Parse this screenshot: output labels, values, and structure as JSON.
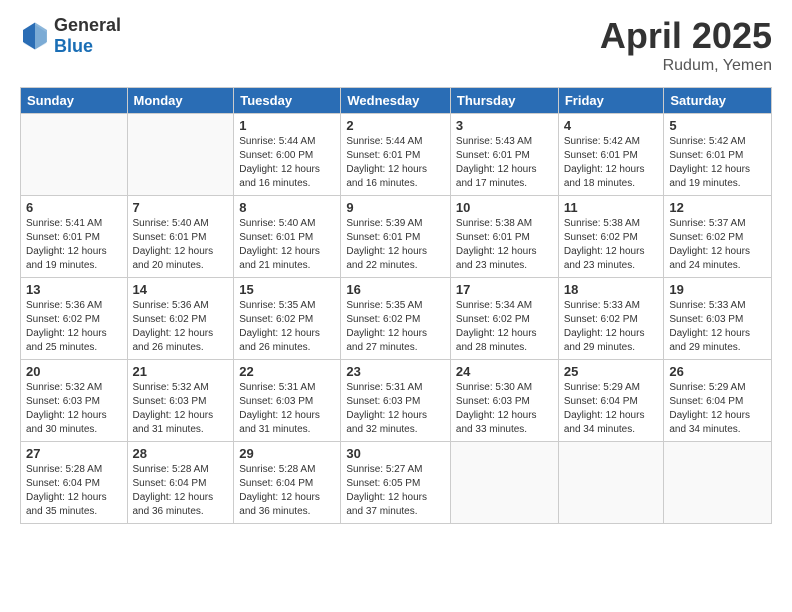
{
  "header": {
    "logo_general": "General",
    "logo_blue": "Blue",
    "month_title": "April 2025",
    "location": "Rudum, Yemen"
  },
  "weekdays": [
    "Sunday",
    "Monday",
    "Tuesday",
    "Wednesday",
    "Thursday",
    "Friday",
    "Saturday"
  ],
  "weeks": [
    [
      {
        "day": "",
        "info": ""
      },
      {
        "day": "",
        "info": ""
      },
      {
        "day": "1",
        "info": "Sunrise: 5:44 AM\nSunset: 6:00 PM\nDaylight: 12 hours and 16 minutes."
      },
      {
        "day": "2",
        "info": "Sunrise: 5:44 AM\nSunset: 6:01 PM\nDaylight: 12 hours and 16 minutes."
      },
      {
        "day": "3",
        "info": "Sunrise: 5:43 AM\nSunset: 6:01 PM\nDaylight: 12 hours and 17 minutes."
      },
      {
        "day": "4",
        "info": "Sunrise: 5:42 AM\nSunset: 6:01 PM\nDaylight: 12 hours and 18 minutes."
      },
      {
        "day": "5",
        "info": "Sunrise: 5:42 AM\nSunset: 6:01 PM\nDaylight: 12 hours and 19 minutes."
      }
    ],
    [
      {
        "day": "6",
        "info": "Sunrise: 5:41 AM\nSunset: 6:01 PM\nDaylight: 12 hours and 19 minutes."
      },
      {
        "day": "7",
        "info": "Sunrise: 5:40 AM\nSunset: 6:01 PM\nDaylight: 12 hours and 20 minutes."
      },
      {
        "day": "8",
        "info": "Sunrise: 5:40 AM\nSunset: 6:01 PM\nDaylight: 12 hours and 21 minutes."
      },
      {
        "day": "9",
        "info": "Sunrise: 5:39 AM\nSunset: 6:01 PM\nDaylight: 12 hours and 22 minutes."
      },
      {
        "day": "10",
        "info": "Sunrise: 5:38 AM\nSunset: 6:01 PM\nDaylight: 12 hours and 23 minutes."
      },
      {
        "day": "11",
        "info": "Sunrise: 5:38 AM\nSunset: 6:02 PM\nDaylight: 12 hours and 23 minutes."
      },
      {
        "day": "12",
        "info": "Sunrise: 5:37 AM\nSunset: 6:02 PM\nDaylight: 12 hours and 24 minutes."
      }
    ],
    [
      {
        "day": "13",
        "info": "Sunrise: 5:36 AM\nSunset: 6:02 PM\nDaylight: 12 hours and 25 minutes."
      },
      {
        "day": "14",
        "info": "Sunrise: 5:36 AM\nSunset: 6:02 PM\nDaylight: 12 hours and 26 minutes."
      },
      {
        "day": "15",
        "info": "Sunrise: 5:35 AM\nSunset: 6:02 PM\nDaylight: 12 hours and 26 minutes."
      },
      {
        "day": "16",
        "info": "Sunrise: 5:35 AM\nSunset: 6:02 PM\nDaylight: 12 hours and 27 minutes."
      },
      {
        "day": "17",
        "info": "Sunrise: 5:34 AM\nSunset: 6:02 PM\nDaylight: 12 hours and 28 minutes."
      },
      {
        "day": "18",
        "info": "Sunrise: 5:33 AM\nSunset: 6:02 PM\nDaylight: 12 hours and 29 minutes."
      },
      {
        "day": "19",
        "info": "Sunrise: 5:33 AM\nSunset: 6:03 PM\nDaylight: 12 hours and 29 minutes."
      }
    ],
    [
      {
        "day": "20",
        "info": "Sunrise: 5:32 AM\nSunset: 6:03 PM\nDaylight: 12 hours and 30 minutes."
      },
      {
        "day": "21",
        "info": "Sunrise: 5:32 AM\nSunset: 6:03 PM\nDaylight: 12 hours and 31 minutes."
      },
      {
        "day": "22",
        "info": "Sunrise: 5:31 AM\nSunset: 6:03 PM\nDaylight: 12 hours and 31 minutes."
      },
      {
        "day": "23",
        "info": "Sunrise: 5:31 AM\nSunset: 6:03 PM\nDaylight: 12 hours and 32 minutes."
      },
      {
        "day": "24",
        "info": "Sunrise: 5:30 AM\nSunset: 6:03 PM\nDaylight: 12 hours and 33 minutes."
      },
      {
        "day": "25",
        "info": "Sunrise: 5:29 AM\nSunset: 6:04 PM\nDaylight: 12 hours and 34 minutes."
      },
      {
        "day": "26",
        "info": "Sunrise: 5:29 AM\nSunset: 6:04 PM\nDaylight: 12 hours and 34 minutes."
      }
    ],
    [
      {
        "day": "27",
        "info": "Sunrise: 5:28 AM\nSunset: 6:04 PM\nDaylight: 12 hours and 35 minutes."
      },
      {
        "day": "28",
        "info": "Sunrise: 5:28 AM\nSunset: 6:04 PM\nDaylight: 12 hours and 36 minutes."
      },
      {
        "day": "29",
        "info": "Sunrise: 5:28 AM\nSunset: 6:04 PM\nDaylight: 12 hours and 36 minutes."
      },
      {
        "day": "30",
        "info": "Sunrise: 5:27 AM\nSunset: 6:05 PM\nDaylight: 12 hours and 37 minutes."
      },
      {
        "day": "",
        "info": ""
      },
      {
        "day": "",
        "info": ""
      },
      {
        "day": "",
        "info": ""
      }
    ]
  ]
}
